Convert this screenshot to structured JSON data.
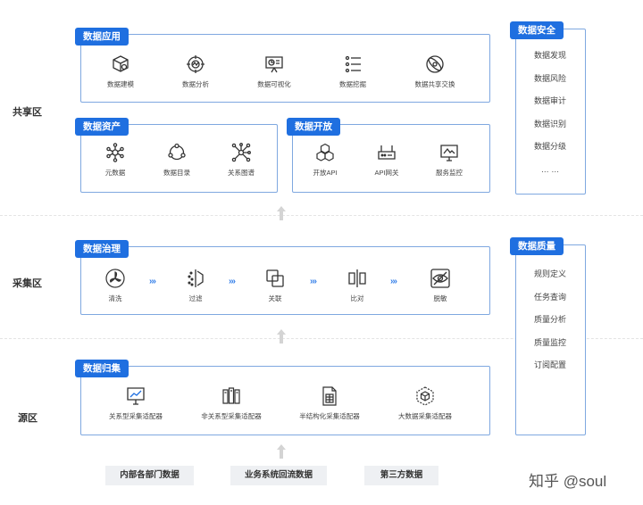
{
  "zones": {
    "share": "共享区",
    "collect": "采集区",
    "source": "源区"
  },
  "app": {
    "title": "数据应用",
    "items": [
      "数据建模",
      "数据分析",
      "数据可视化",
      "数据挖掘",
      "数据共享交换"
    ]
  },
  "assets": {
    "title": "数据资产",
    "items": [
      "元数据",
      "数据目录",
      "关系图谱"
    ]
  },
  "open": {
    "title": "数据开放",
    "items": [
      "开放API",
      "API网关",
      "服务监控"
    ]
  },
  "governance": {
    "title": "数据治理",
    "items": [
      "清洗",
      "过滤",
      "关联",
      "比对",
      "脱敏"
    ],
    "arrow": "›››"
  },
  "ingest": {
    "title": "数据归集",
    "items": [
      "关系型采集适配器",
      "非关系型采集适配器",
      "半结构化采集适配器",
      "大数据采集适配器"
    ]
  },
  "security": {
    "title": "数据安全",
    "items": [
      "数据发现",
      "数据风险",
      "数据审计",
      "数据识别",
      "数据分级",
      "… …"
    ]
  },
  "quality": {
    "title": "数据质量",
    "items": [
      "规则定义",
      "任务查询",
      "质量分析",
      "质量监控",
      "订阅配置"
    ]
  },
  "sources": [
    "内部各部门数据",
    "业务系统回流数据",
    "第三方数据"
  ],
  "watermark": "知乎 @soul",
  "colors": {
    "accent": "#1f6fe0",
    "border": "#7fa8e0",
    "arrow": "#2f7ce8",
    "source_bg": "#eef0f3"
  },
  "icons": {
    "app": [
      "cube-model-icon",
      "target-analysis-icon",
      "presentation-chart-icon",
      "mining-list-icon",
      "exchange-orbit-icon"
    ],
    "assets": [
      "molecule-icon",
      "circle-nodes-icon",
      "network-graph-icon"
    ],
    "open": [
      "hex-cubes-icon",
      "router-gateway-icon",
      "monitor-chart-icon"
    ],
    "governance": [
      "fan-clean-icon",
      "filter-funnel-icon",
      "link-squares-icon",
      "compare-bars-icon",
      "eye-hidden-icon"
    ],
    "ingest": [
      "monitor-db-icon",
      "server-stack-icon",
      "document-table-icon",
      "hex-bigdata-icon"
    ]
  }
}
